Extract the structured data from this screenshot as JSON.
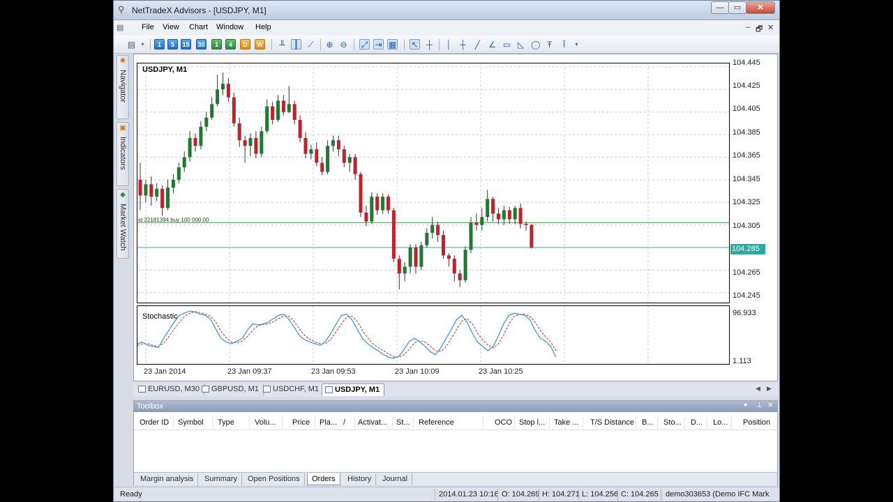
{
  "window": {
    "title": "NetTradeX Advisors - [USDJPY, M1]",
    "controls": {
      "minimize": "—",
      "maximize": "▭",
      "close": "✕"
    }
  },
  "menu": {
    "items": [
      "File",
      "View",
      "Chart",
      "Window",
      "Help"
    ],
    "mdi_controls": {
      "minimize": "–",
      "restore": "🗗",
      "close": "✕"
    }
  },
  "toolbar": {
    "timeframes": [
      "1",
      "5",
      "15",
      "30",
      "1",
      "4",
      "D",
      "W"
    ]
  },
  "side_panels": [
    "Navigator",
    "Indicators",
    "Market Watch"
  ],
  "chart": {
    "symbol_label": "USDJPY, M1",
    "indicator_label": "Stochastic",
    "order_line_label": "id 22181394 buy 100 000.00",
    "price_labels": [
      "104.445",
      "104.425",
      "104.405",
      "104.385",
      "104.365",
      "104.345",
      "104.325",
      "104.305",
      "104.265",
      "104.245"
    ],
    "current_price": "104.285",
    "stoch_labels": [
      "96.933",
      "1.113"
    ],
    "time_labels": [
      "23 Jan 2014",
      "23 Jan 09:37",
      "23 Jan 09:53",
      "23 Jan 10:09",
      "23 Jan 10:25"
    ],
    "colors": {
      "bull": "#1e7a32",
      "bear": "#c0212b",
      "price_line": "#2fa8a0",
      "order_line": "#3f9a52",
      "stoch_main": "#3b8fc7",
      "stoch_signal": "#c0212b"
    }
  },
  "chart_data": {
    "type": "candlestick",
    "symbol": "USDJPY",
    "timeframe": "M1",
    "price_range": [
      104.235,
      104.448
    ],
    "order_price": 104.307,
    "current_price": 104.285,
    "candles": [
      [
        104.345,
        104.331,
        104.36,
        104.318
      ],
      [
        104.331,
        104.341,
        104.345,
        104.325
      ],
      [
        104.341,
        104.33,
        104.348,
        104.322
      ],
      [
        104.33,
        104.337,
        104.342,
        104.326
      ],
      [
        104.337,
        104.32,
        104.34,
        104.313
      ],
      [
        104.32,
        104.338,
        104.345,
        104.318
      ],
      [
        104.338,
        104.345,
        104.35,
        104.333
      ],
      [
        104.345,
        104.356,
        104.36,
        104.342
      ],
      [
        104.356,
        104.365,
        104.37,
        104.352
      ],
      [
        104.365,
        104.382,
        104.388,
        104.361
      ],
      [
        104.382,
        104.375,
        104.386,
        104.37
      ],
      [
        104.375,
        104.392,
        104.397,
        104.372
      ],
      [
        104.392,
        104.4,
        104.405,
        104.388
      ],
      [
        104.4,
        104.412,
        104.418,
        104.398
      ],
      [
        104.412,
        104.425,
        104.438,
        104.41
      ],
      [
        104.425,
        104.43,
        104.44,
        104.42
      ],
      [
        104.43,
        104.418,
        104.435,
        104.414
      ],
      [
        104.418,
        104.395,
        104.422,
        104.392
      ],
      [
        104.395,
        104.38,
        104.4,
        104.374
      ],
      [
        104.38,
        104.375,
        104.384,
        104.36
      ],
      [
        104.375,
        104.382,
        104.386,
        104.366
      ],
      [
        104.382,
        104.368,
        104.388,
        104.364
      ],
      [
        104.368,
        104.388,
        104.392,
        104.365
      ],
      [
        104.388,
        104.41,
        104.416,
        104.386
      ],
      [
        104.41,
        104.398,
        104.414,
        104.394
      ],
      [
        104.398,
        104.415,
        104.42,
        104.396
      ],
      [
        104.415,
        104.405,
        104.42,
        104.402
      ],
      [
        104.405,
        104.412,
        104.428,
        104.404
      ],
      [
        104.412,
        104.398,
        104.415,
        104.394
      ],
      [
        104.398,
        104.382,
        104.402,
        104.378
      ],
      [
        104.382,
        104.368,
        104.387,
        104.364
      ],
      [
        104.368,
        104.372,
        104.376,
        104.363
      ],
      [
        104.372,
        104.36,
        104.378,
        104.357
      ],
      [
        104.36,
        104.352,
        104.365,
        104.349
      ],
      [
        104.352,
        104.375,
        104.38,
        104.35
      ],
      [
        104.375,
        104.38,
        104.384,
        104.37
      ],
      [
        104.38,
        104.372,
        104.384,
        104.366
      ],
      [
        104.372,
        104.36,
        104.375,
        104.356
      ],
      [
        104.36,
        104.365,
        104.368,
        104.352
      ],
      [
        104.365,
        104.35,
        104.368,
        104.345
      ],
      [
        104.35,
        104.316,
        104.352,
        104.312
      ],
      [
        104.316,
        104.308,
        104.322,
        104.304
      ],
      [
        104.308,
        104.33,
        104.334,
        104.306
      ],
      [
        104.33,
        104.318,
        104.333,
        104.314
      ],
      [
        104.318,
        104.33,
        104.333,
        104.315
      ],
      [
        104.33,
        104.318,
        104.332,
        104.315
      ],
      [
        104.318,
        104.275,
        104.32,
        104.272
      ],
      [
        104.275,
        104.262,
        104.278,
        104.248
      ],
      [
        104.262,
        104.268,
        104.272,
        104.255
      ],
      [
        104.268,
        104.285,
        104.288,
        104.262
      ],
      [
        104.285,
        104.268,
        104.288,
        104.262
      ],
      [
        104.268,
        104.287,
        104.29,
        104.265
      ],
      [
        104.287,
        104.298,
        104.302,
        104.285
      ],
      [
        104.298,
        104.305,
        104.312,
        104.293
      ],
      [
        104.305,
        104.296,
        104.308,
        104.29
      ],
      [
        104.296,
        104.278,
        104.3,
        104.275
      ],
      [
        104.278,
        104.275,
        104.28,
        104.268
      ],
      [
        104.275,
        104.262,
        104.278,
        104.255
      ],
      [
        104.262,
        104.256,
        104.265,
        104.25
      ],
      [
        104.256,
        104.283,
        104.286,
        104.254
      ],
      [
        104.283,
        104.307,
        104.312,
        104.28
      ],
      [
        104.307,
        104.305,
        104.315,
        104.3
      ],
      [
        104.305,
        104.312,
        104.32,
        104.3
      ],
      [
        104.312,
        104.328,
        104.336,
        104.308
      ],
      [
        104.328,
        104.315,
        104.33,
        104.308
      ],
      [
        104.315,
        104.31,
        104.32,
        104.306
      ],
      [
        104.31,
        104.318,
        104.322,
        104.305
      ],
      [
        104.318,
        104.31,
        104.321,
        104.306
      ],
      [
        104.31,
        104.32,
        104.322,
        104.306
      ],
      [
        104.32,
        104.306,
        104.324,
        104.302
      ],
      [
        104.306,
        104.305,
        104.308,
        104.3
      ],
      [
        104.305,
        104.285,
        104.306,
        104.284
      ]
    ],
    "candle_format": [
      "open",
      "close",
      "high",
      "low"
    ],
    "stochastic": {
      "range": [
        1.113,
        96.933
      ],
      "main": [
        35,
        38,
        32,
        30,
        28,
        45,
        60,
        75,
        88,
        92,
        96,
        94,
        90,
        88,
        80,
        62,
        45,
        38,
        35,
        40,
        45,
        60,
        72,
        70,
        72,
        75,
        82,
        88,
        90,
        80,
        65,
        50,
        42,
        38,
        35,
        32,
        40,
        55,
        72,
        88,
        90,
        80,
        62,
        45,
        35,
        28,
        22,
        15,
        10,
        8,
        12,
        25,
        40,
        45,
        38,
        30,
        20,
        15,
        28,
        45,
        62,
        80,
        88,
        75,
        55,
        38,
        30,
        22,
        30,
        50,
        72,
        88,
        92,
        90,
        88,
        80,
        60,
        45,
        40,
        30,
        10
      ],
      "signal": [
        32,
        35,
        35,
        32,
        30,
        36,
        48,
        62,
        75,
        86,
        92,
        95,
        93,
        90,
        86,
        75,
        58,
        46,
        38,
        37,
        40,
        48,
        60,
        68,
        71,
        72,
        76,
        82,
        87,
        86,
        76,
        62,
        50,
        43,
        38,
        35,
        36,
        44,
        58,
        72,
        85,
        86,
        77,
        60,
        46,
        35,
        28,
        22,
        16,
        11,
        10,
        15,
        26,
        37,
        41,
        38,
        30,
        22,
        21,
        30,
        45,
        62,
        77,
        82,
        72,
        55,
        42,
        32,
        27,
        35,
        52,
        72,
        86,
        90,
        90,
        86,
        75,
        60,
        48,
        38,
        22
      ]
    },
    "time_labels": [
      "23 Jan 2014",
      "23 Jan 09:37",
      "23 Jan 09:53",
      "23 Jan 10:09",
      "23 Jan 10:25"
    ]
  },
  "chart_tabs": [
    {
      "label": "EURUSD, M30",
      "active": false
    },
    {
      "label": "GBPUSD, M1",
      "active": false
    },
    {
      "label": "USDCHF, M1",
      "active": false
    },
    {
      "label": "USDJPY, M1",
      "active": true
    }
  ],
  "toolbox": {
    "title": "Toolbox",
    "columns": [
      "Order ID",
      "Symbol",
      "Type",
      "Volu...",
      "Price",
      "Pla...",
      "/",
      "Activat...",
      "St...",
      "Reference",
      "OCO",
      "Stop l...",
      "Take ...",
      "T/S Distance",
      "B...",
      "Sto...",
      "D...",
      "Lo...",
      "Position"
    ],
    "tabs": [
      {
        "label": "Margin analysis",
        "active": false
      },
      {
        "label": "Summary",
        "active": false
      },
      {
        "label": "Open Positions",
        "active": false
      },
      {
        "label": "Orders",
        "active": true
      },
      {
        "label": "History",
        "active": false
      },
      {
        "label": "Journal",
        "active": false
      }
    ]
  },
  "status": {
    "ready": "Ready",
    "datetime": "2014.01.23 10:16",
    "open": "O: 104.269",
    "high": "H: 104.271",
    "low": "L: 104.256",
    "close": "C: 104.265",
    "account": "demo303653 (Demo IFC Mark"
  }
}
